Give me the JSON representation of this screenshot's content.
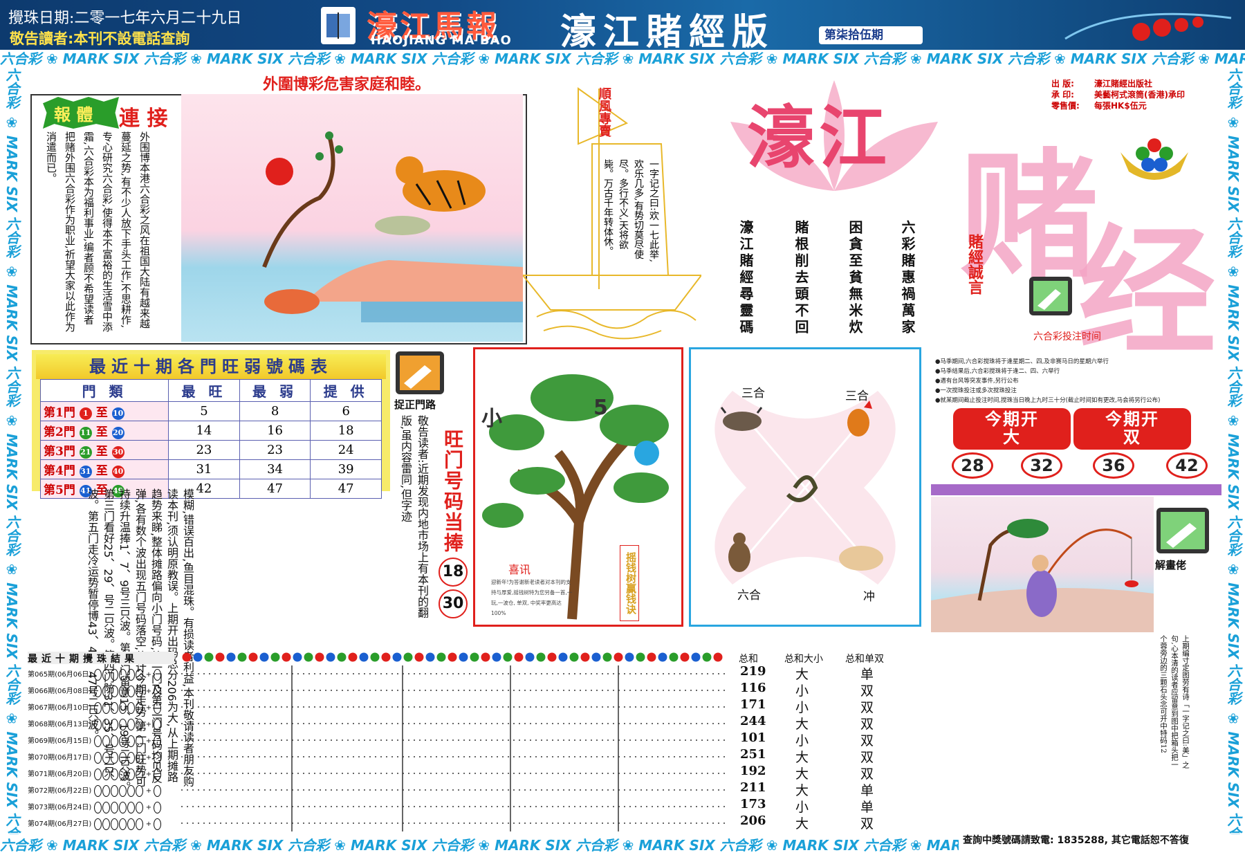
{
  "header": {
    "date": "攪珠日期:二零一七年六月二十九日",
    "warning": "敬告讀者:本刊不設電話查詢",
    "logo_cn": "濠江馬報",
    "logo_en": "HAOJIANG MA BAO",
    "edition": "濠江賭經版",
    "issue": "第柒拾伍期"
  },
  "strip_text": "六合彩 ❀ MARK SIX 六合彩 ❀ MARK SIX 六合彩 ❀ MARK SIX 六合彩 ❀ MARK SIX 六合彩 ❀ MARK SIX 六合彩 ❀ MARK SIX 六合彩 ❀ MARK SIX 六合彩 ❀ MARK SIX 六合彩 ❀ MARK SIX 六合彩 ❀ MARK SIX 六合彩 ❀ MARK SIX",
  "lead": {
    "headline": "外圍博彩危害家庭和睦。",
    "badge": "報 體",
    "title": "連 接",
    "text": "外围博本港六合彩之风在祖国大陆有越来越蔓延之势,有不少人放下手头工作,不思耕作,专心研究六合彩,使得本不富裕的生活雪中添霜,六合彩本为福利事业,编者顾不希望读者把赌外围六合彩作为职业,祈望大家以此作为消遣而已。"
  },
  "sail": {
    "title": "順風專賣",
    "text": "一字记之曰:欢一七此举,欢乐几多,有势切莫尽使尽。多行不义,天将欲毙。万古千年转体休。"
  },
  "poem": {
    "cols": [
      "六彩賭惠禍萬家",
      "困貪至貧無米炊",
      "賭根削去頭不回",
      "濠江賭經尋靈碼"
    ]
  },
  "brand": {
    "big1": "濠江",
    "big2": "赌",
    "big3": "经",
    "motto": "賭經誠言",
    "publisher_label": "出  版:",
    "publisher": "濠江賭經出版社",
    "printer_label": "承  印:",
    "printer": "美藝柯式滾筒(香港)承印",
    "price_label": "零售價:",
    "price": "每張HK$伍元",
    "bet_time_title": "六合彩投注时间",
    "bet_notes": [
      "●马季期间,六合彩搅珠将于逢星期二、四,及非赛马日的星期六举行",
      "●马季结果后,六合彩搅珠将于逢二、四、六举行",
      "●遇有台风等突发事件,另行公布",
      "●一次搅珠投注或多次搅珠投注",
      "●就某期间截止投注时间,搅珠当日晚上九时三十分(截止时间如有更改,马会将另行公布)"
    ]
  },
  "table": {
    "title": "最近十期各門旺弱號碼表",
    "headers": [
      "門 類",
      "最 旺",
      "最 弱",
      "提 供"
    ],
    "rows": [
      {
        "gate": "第1門",
        "from": "1",
        "to": "10",
        "from_color": "#e0201c",
        "to_color": "#1a5fd0",
        "hot": "5",
        "cold": "8",
        "tip": "6"
      },
      {
        "gate": "第2門",
        "from": "11",
        "to": "20",
        "from_color": "#2a9d2a",
        "to_color": "#1a5fd0",
        "hot": "14",
        "cold": "16",
        "tip": "18"
      },
      {
        "gate": "第3門",
        "from": "21",
        "to": "30",
        "from_color": "#2a9d2a",
        "to_color": "#e0201c",
        "hot": "23",
        "cold": "23",
        "tip": "24"
      },
      {
        "gate": "第4門",
        "from": "31",
        "to": "40",
        "from_color": "#1a5fd0",
        "to_color": "#e0201c",
        "hot": "31",
        "cold": "34",
        "tip": "39"
      },
      {
        "gate": "第5門",
        "from": "41",
        "to": "49",
        "from_color": "#1a5fd0",
        "to_color": "#2a9d2a",
        "hot": "42",
        "cold": "47",
        "tip": "47"
      }
    ],
    "range_sep": "至"
  },
  "article": {
    "text": "模糊,错误百出,鱼目混珠。有损读者利益,本刊敬请读者朋友购读本刊,须认明原教误。上期开出码总分206为大,从上期摊路趋势来睇,整体摊路偏向小门号码,第一门及第二门号码均见反弹,各有数个波出现五门号码落空,估计今期走势,第一门旺势可持续升温捧1、7、9号三只波。第二门留意15、19号二只波。第三门看好25、29、号二只波。第四门防31、35、号二只波。第五门走冷运势暂停博43、46、47号二只波。"
  },
  "notice": {
    "label": "捉正門路",
    "text": "敬告读者:近期发现内地市场上有本刊的翻版,虽内容雷同,但字迹"
  },
  "hot": {
    "title": "旺门号码当捧",
    "numbers": [
      "18",
      "30"
    ]
  },
  "tree": {
    "num_left": "小",
    "num_right": "5",
    "caption": "摇钱树赢钱诀",
    "news_title": "喜讯",
    "news": "迎新年!为答谢新老读者对本刊的支持与厚爱,摇钱树特为您另备一首,一玩,一波仓, 单双, 中奖率更高达100%"
  },
  "zodiac": {
    "top_left": "三合",
    "top_right": "三合",
    "bottom_left": "六合",
    "bottom_right": "冲"
  },
  "current": {
    "tab1_title": "今期开",
    "tab1_value": "大",
    "tab2_title": "今期开",
    "tab2_value": "双",
    "numbers": [
      "28",
      "32",
      "36",
      "42"
    ]
  },
  "fish": {
    "label": "解畫佬",
    "text": "上期编寸定图劳有诗「一字记之曰:美」之句,心本清的读者应留意到图中把箱头把一个蓉旁边的三颗石头念可开中特码12"
  },
  "results": {
    "title": "最近十期攪珠結果",
    "hdr_sum": "总和",
    "hdr_size": "总和大小",
    "hdr_parity": "总和单双",
    "rows": [
      {
        "label": "第065期(06月06日)",
        "sum": "219",
        "size": "大",
        "parity": "单"
      },
      {
        "label": "第066期(06月08日)",
        "sum": "116",
        "size": "小",
        "parity": "双"
      },
      {
        "label": "第067期(06月10日)",
        "sum": "171",
        "size": "小",
        "parity": "双"
      },
      {
        "label": "第068期(06月13日)",
        "sum": "244",
        "size": "大",
        "parity": "双"
      },
      {
        "label": "第069期(06月15日)",
        "sum": "101",
        "size": "小",
        "parity": "双"
      },
      {
        "label": "第070期(06月17日)",
        "sum": "251",
        "size": "大",
        "parity": "双"
      },
      {
        "label": "第071期(06月20日)",
        "sum": "192",
        "size": "大",
        "parity": "双"
      },
      {
        "label": "第072期(06月22日)",
        "sum": "211",
        "size": "大",
        "parity": "单"
      },
      {
        "label": "第073期(06月24日)",
        "sum": "173",
        "size": "小",
        "parity": "单"
      },
      {
        "label": "第074期(06月27日)",
        "sum": "206",
        "size": "大",
        "parity": "双"
      }
    ]
  },
  "footer": {
    "note": "查詢中獎號碼請致電: 1835288, 其它電話恕不答復"
  }
}
